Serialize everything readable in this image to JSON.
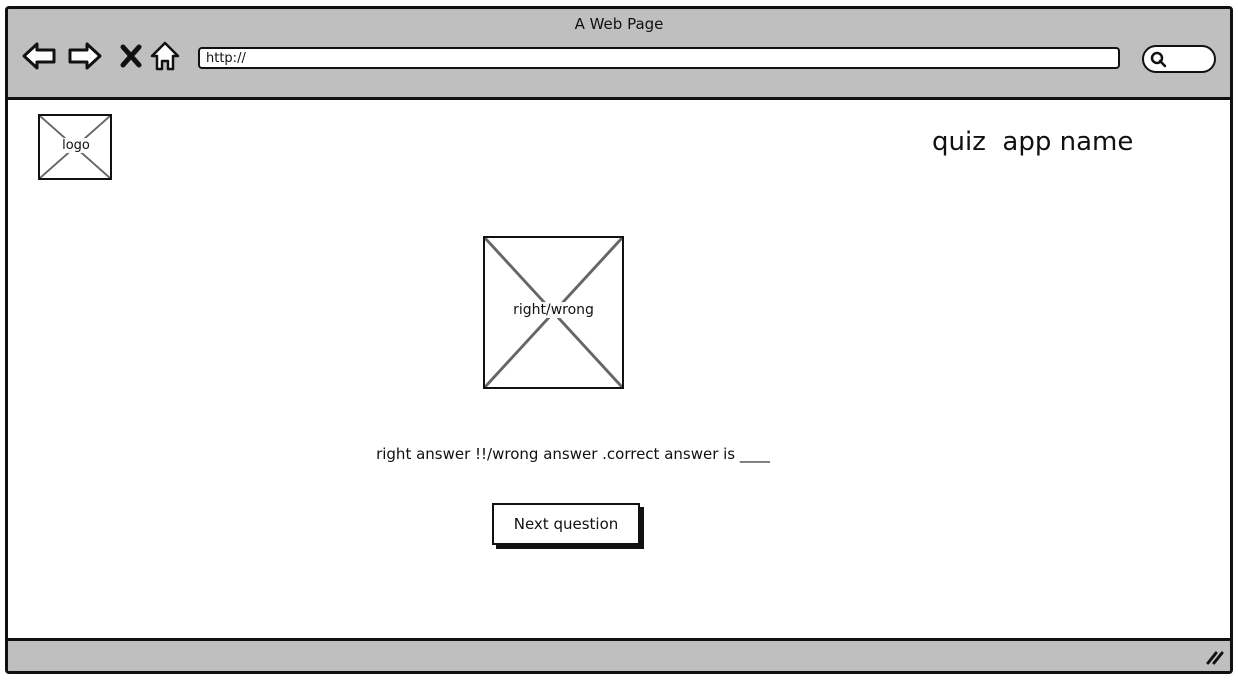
{
  "window": {
    "title": "A Web Page"
  },
  "toolbar": {
    "back_icon": "arrow-left-icon",
    "forward_icon": "arrow-right-icon",
    "stop_icon": "close-icon",
    "home_icon": "home-icon",
    "url_value": "http://",
    "search_icon": "search-icon"
  },
  "header": {
    "logo_label": "logo",
    "app_name": "quiz  app name"
  },
  "main": {
    "result_image_label": "right/wrong",
    "feedback_text": "right answer !!/wrong answer .correct answer is ____",
    "next_button_label": "Next question"
  },
  "colors": {
    "chrome": "#bfbfbf",
    "border": "#111111",
    "placeholder_cross": "#666666"
  }
}
